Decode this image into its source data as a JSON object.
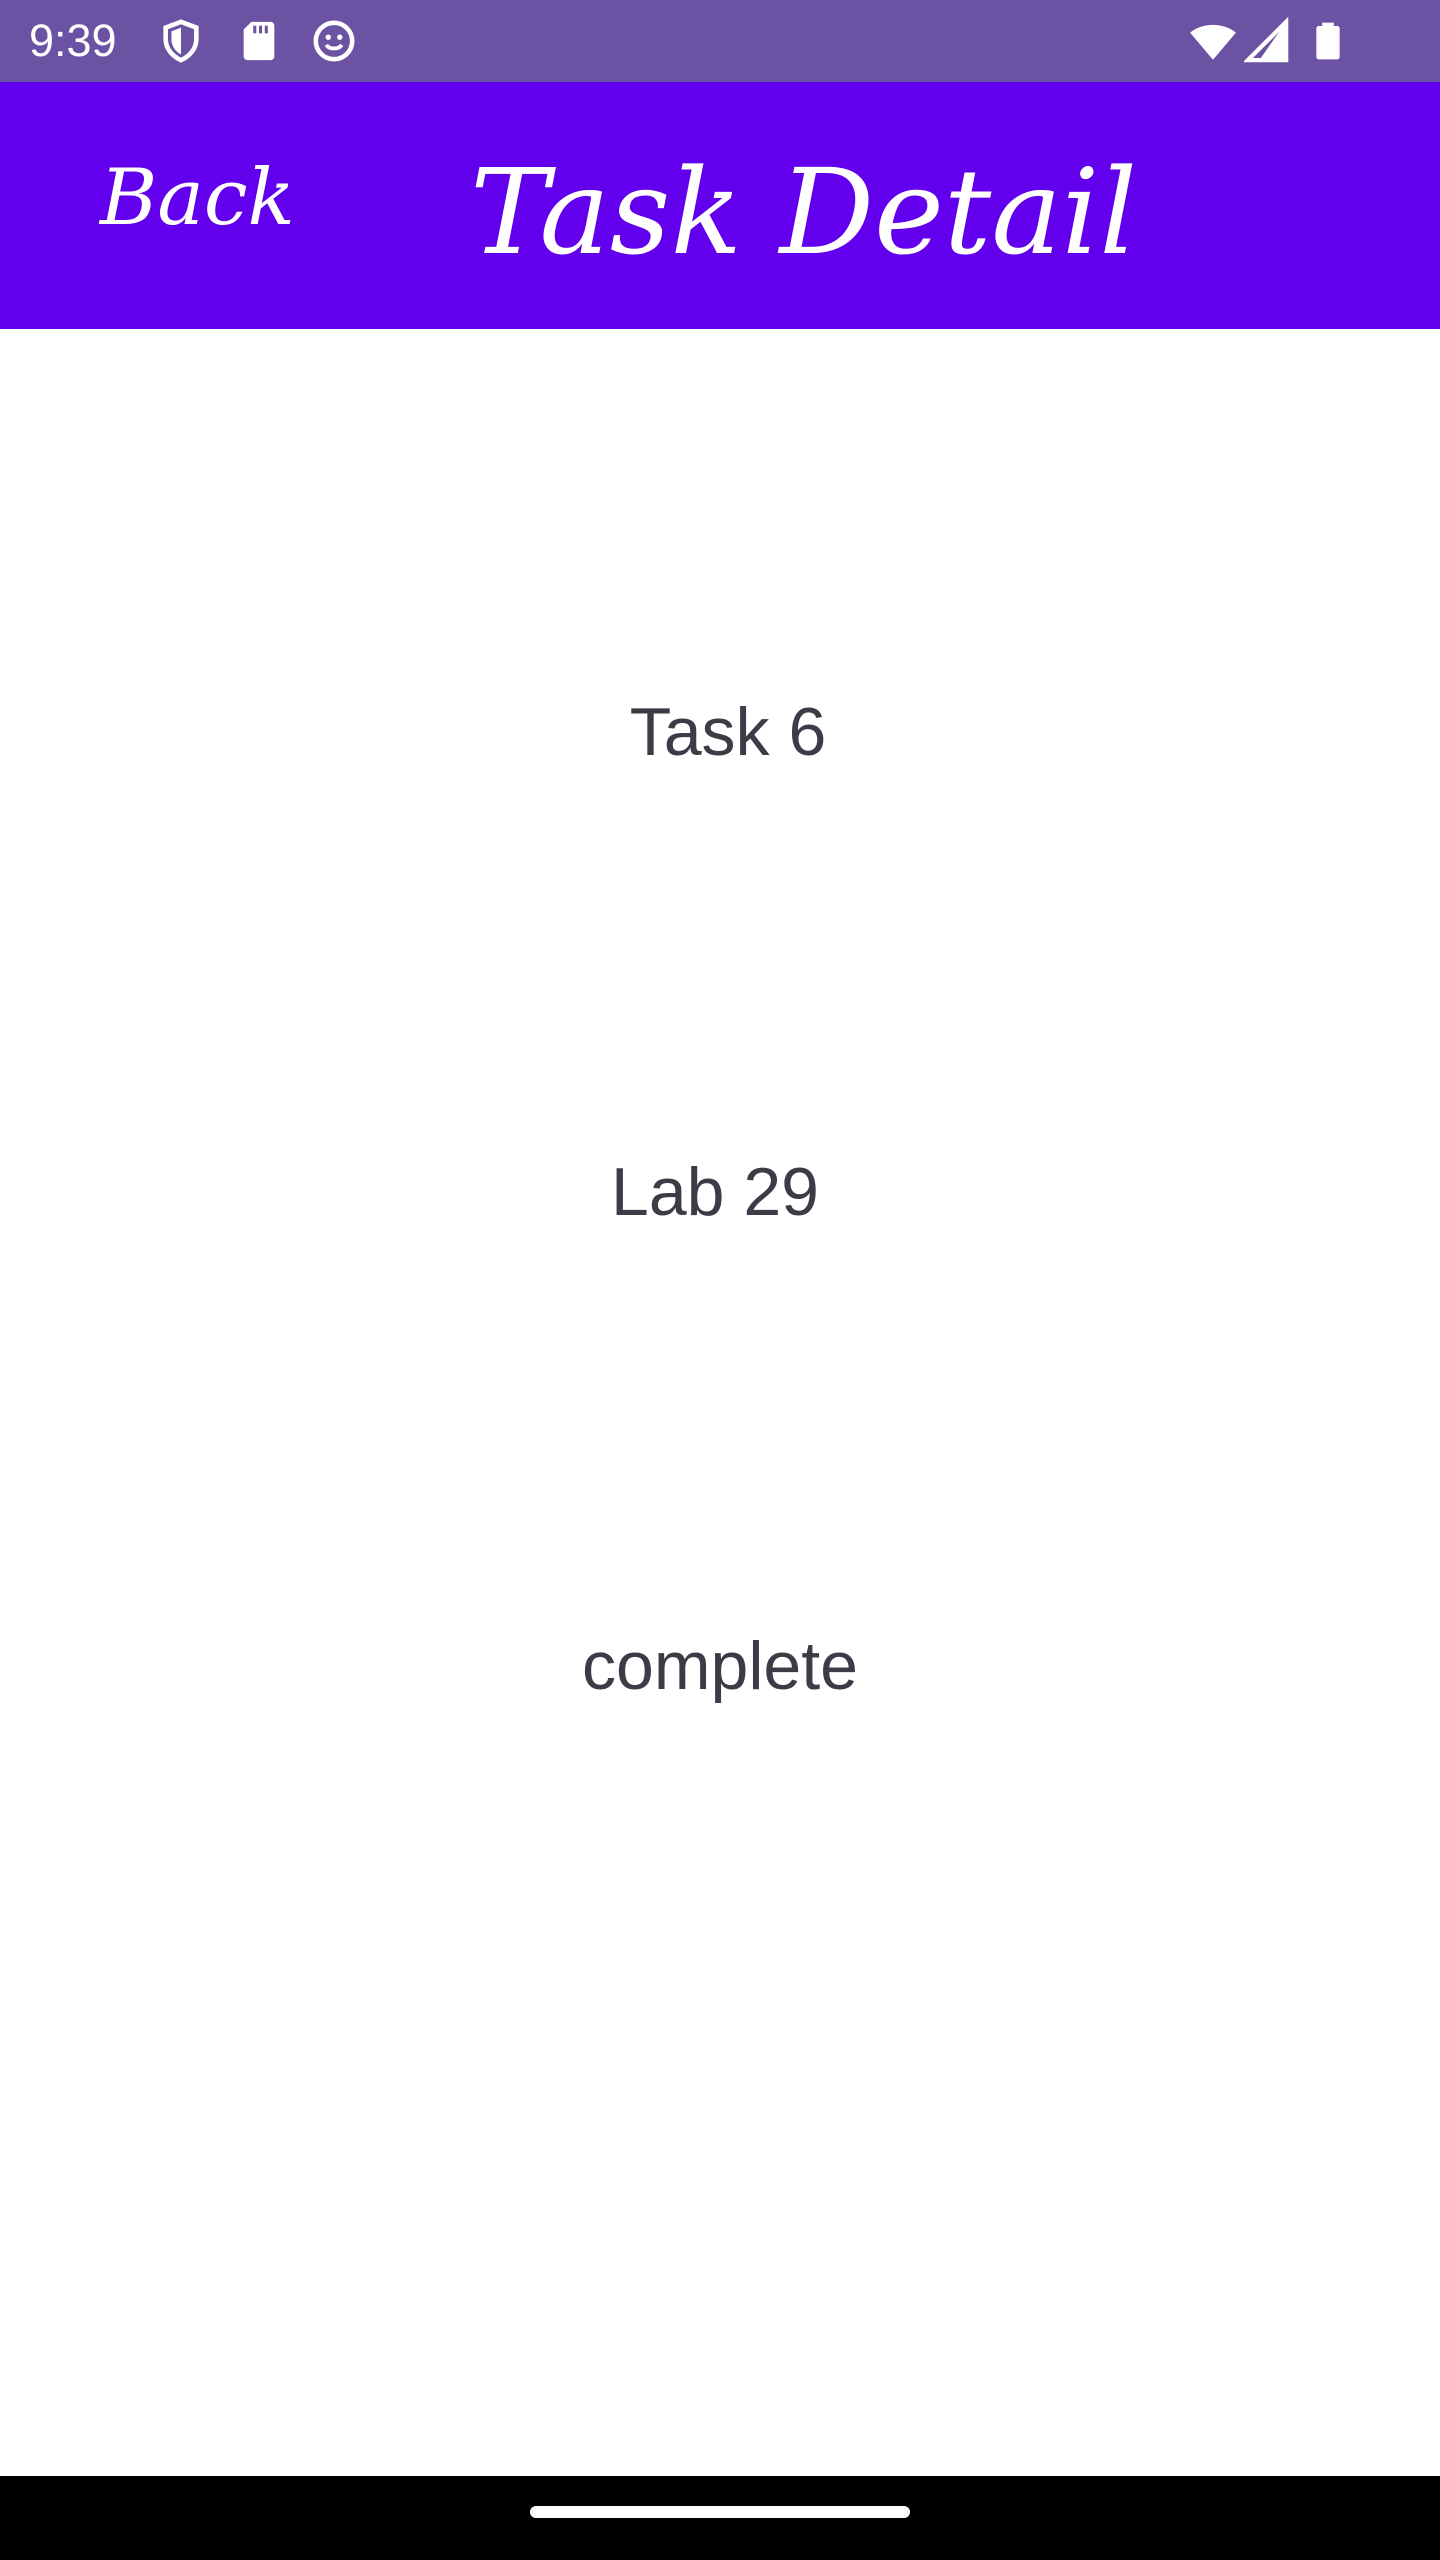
{
  "status_bar": {
    "time": "9:39",
    "left_icons": [
      "shield-icon",
      "sd-card-icon",
      "smiley-face-icon"
    ],
    "right_icons": [
      "wifi-icon",
      "signal-icon",
      "battery-icon"
    ],
    "background": "#6b52a3"
  },
  "app_bar": {
    "back_label": "Back",
    "title": "Task Detail",
    "background": "#6200ee"
  },
  "task": {
    "title": "Task 6",
    "body": "Lab 29",
    "state": "complete"
  },
  "colors": {
    "text": "#3c3b46",
    "nav_bar": "#000000"
  }
}
